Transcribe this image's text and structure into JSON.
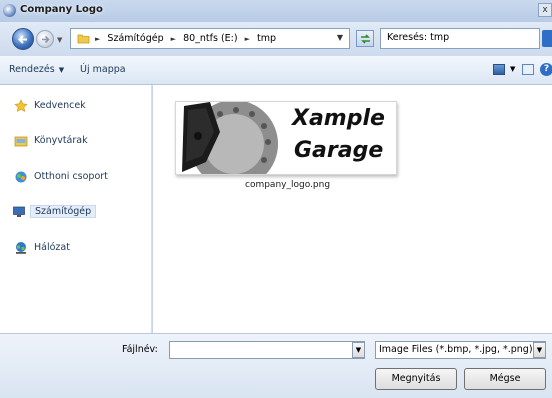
{
  "window": {
    "title": "Company Logo"
  },
  "address": {
    "crumbs": [
      "Számítógép",
      "80_ntfs (E:)",
      "tmp"
    ]
  },
  "search": {
    "value": "Keresés: tmp"
  },
  "toolbar": {
    "organize_label": "Rendezés",
    "new_folder_label": "Új mappa"
  },
  "sidebar": {
    "items": [
      {
        "label": "Kedvencek",
        "icon": "star-icon"
      },
      {
        "label": "Könyvtárak",
        "icon": "libraries-icon"
      },
      {
        "label": "Otthoni csoport",
        "icon": "homegroup-icon"
      },
      {
        "label": "Számítógép",
        "icon": "computer-icon",
        "selected": true
      },
      {
        "label": "Hálózat",
        "icon": "network-icon"
      }
    ]
  },
  "files": [
    {
      "name": "company_logo.png",
      "thumb_text_1": "Xample",
      "thumb_text_2": "Garage"
    }
  ],
  "footer": {
    "filename_label": "Fájlnév:",
    "filename_value": "",
    "filetype": "Image Files (*.bmp, *.jpg, *.png)",
    "open_label": "Megnyitás",
    "cancel_label": "Mégse"
  }
}
